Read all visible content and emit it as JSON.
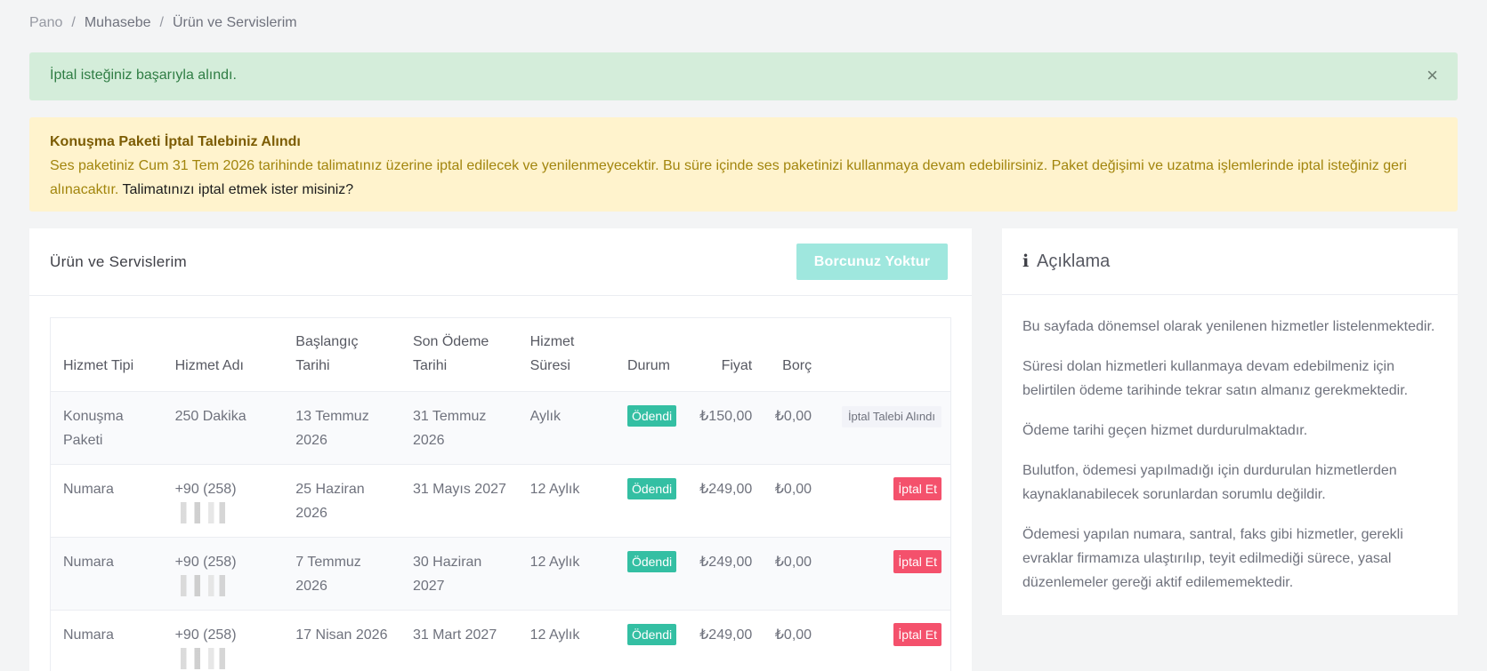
{
  "breadcrumb": [
    "Pano",
    "Muhasebe",
    "Ürün ve Servislerim"
  ],
  "success_alert": {
    "text": "İptal isteğiniz başarıyla alındı.",
    "close": "×"
  },
  "warning_alert": {
    "title": "Konuşma Paketi İptal Talebiniz Alındı",
    "text": "Ses paketiniz Cum 31 Tem 2026 tarihinde talimatınız üzerine iptal edilecek ve yenilenmeyecektir. Bu süre içinde ses paketinizi kullanmaya devam edebilirsiniz. Paket değişimi ve uzatma işlemlerinde iptal isteğiniz geri alınacaktır. ",
    "link": "Talimatınızı iptal etmek ister misiniz?"
  },
  "services": {
    "title": "Ürün ve Servislerim",
    "debt_button": "Borcunuz Yoktur",
    "columns": [
      "Hizmet Tipi",
      "Hizmet Adı",
      "Başlangıç Tarihi",
      "Son Ödeme Tarihi",
      "Hizmet Süresi",
      "Durum",
      "Fiyat",
      "Borç"
    ],
    "rows": [
      {
        "type": "Konuşma Paketi",
        "name": "250 Dakika",
        "start": "13 Temmuz 2026",
        "due": "31 Temmuz 2026",
        "period": "Aylık",
        "status": "Ödendi",
        "price": "₺150,00",
        "debt": "₺0,00",
        "action": "İptal Talebi Alındı"
      },
      {
        "type": "Numara",
        "name": "+90 (258)",
        "start": "25 Haziran 2026",
        "due": "31 Mayıs 2027",
        "period": "12 Aylık",
        "status": "Ödendi",
        "price": "₺249,00",
        "debt": "₺0,00",
        "action": "İptal Et"
      },
      {
        "type": "Numara",
        "name": "+90 (258)",
        "start": "7 Temmuz 2026",
        "due": "30 Haziran 2027",
        "period": "12 Aylık",
        "status": "Ödendi",
        "price": "₺249,00",
        "debt": "₺0,00",
        "action": "İptal Et"
      },
      {
        "type": "Numara",
        "name": "+90 (258)",
        "start": "17 Nisan 2026",
        "due": "31 Mart 2027",
        "period": "12 Aylık",
        "status": "Ödendi",
        "price": "₺249,00",
        "debt": "₺0,00",
        "action": "İptal Et"
      }
    ]
  },
  "info": {
    "icon": "info-icon",
    "title": "Açıklama",
    "paragraphs": [
      "Bu sayfada dönemsel olarak yenilenen hizmetler listelenmektedir.",
      "Süresi dolan hizmetleri kullanmaya devam edebilmeniz için belirtilen ödeme tarihinde tekrar satın almanız gerekmektedir.",
      "Ödeme tarihi geçen hizmet durdurulmaktadır.",
      "Bulutfon, ödemesi yapılmadığı için durdurulan hizmetlerden kaynaklanabilecek sorunlardan sorumlu değildir.",
      "Ödemesi yapılan numara, santral, faks gibi hizmetler, gerekli evraklar firmamıza ulaştırılıp, teyit edilmediği sürece, yasal düzenlemeler gereği aktif edilememektedir."
    ]
  },
  "colors": {
    "success_bg": "#d4edda",
    "warning_bg": "#fff3cd",
    "paid": "#34bfa3",
    "cancel": "#f4516c",
    "debt_button": "#9fe7de"
  }
}
